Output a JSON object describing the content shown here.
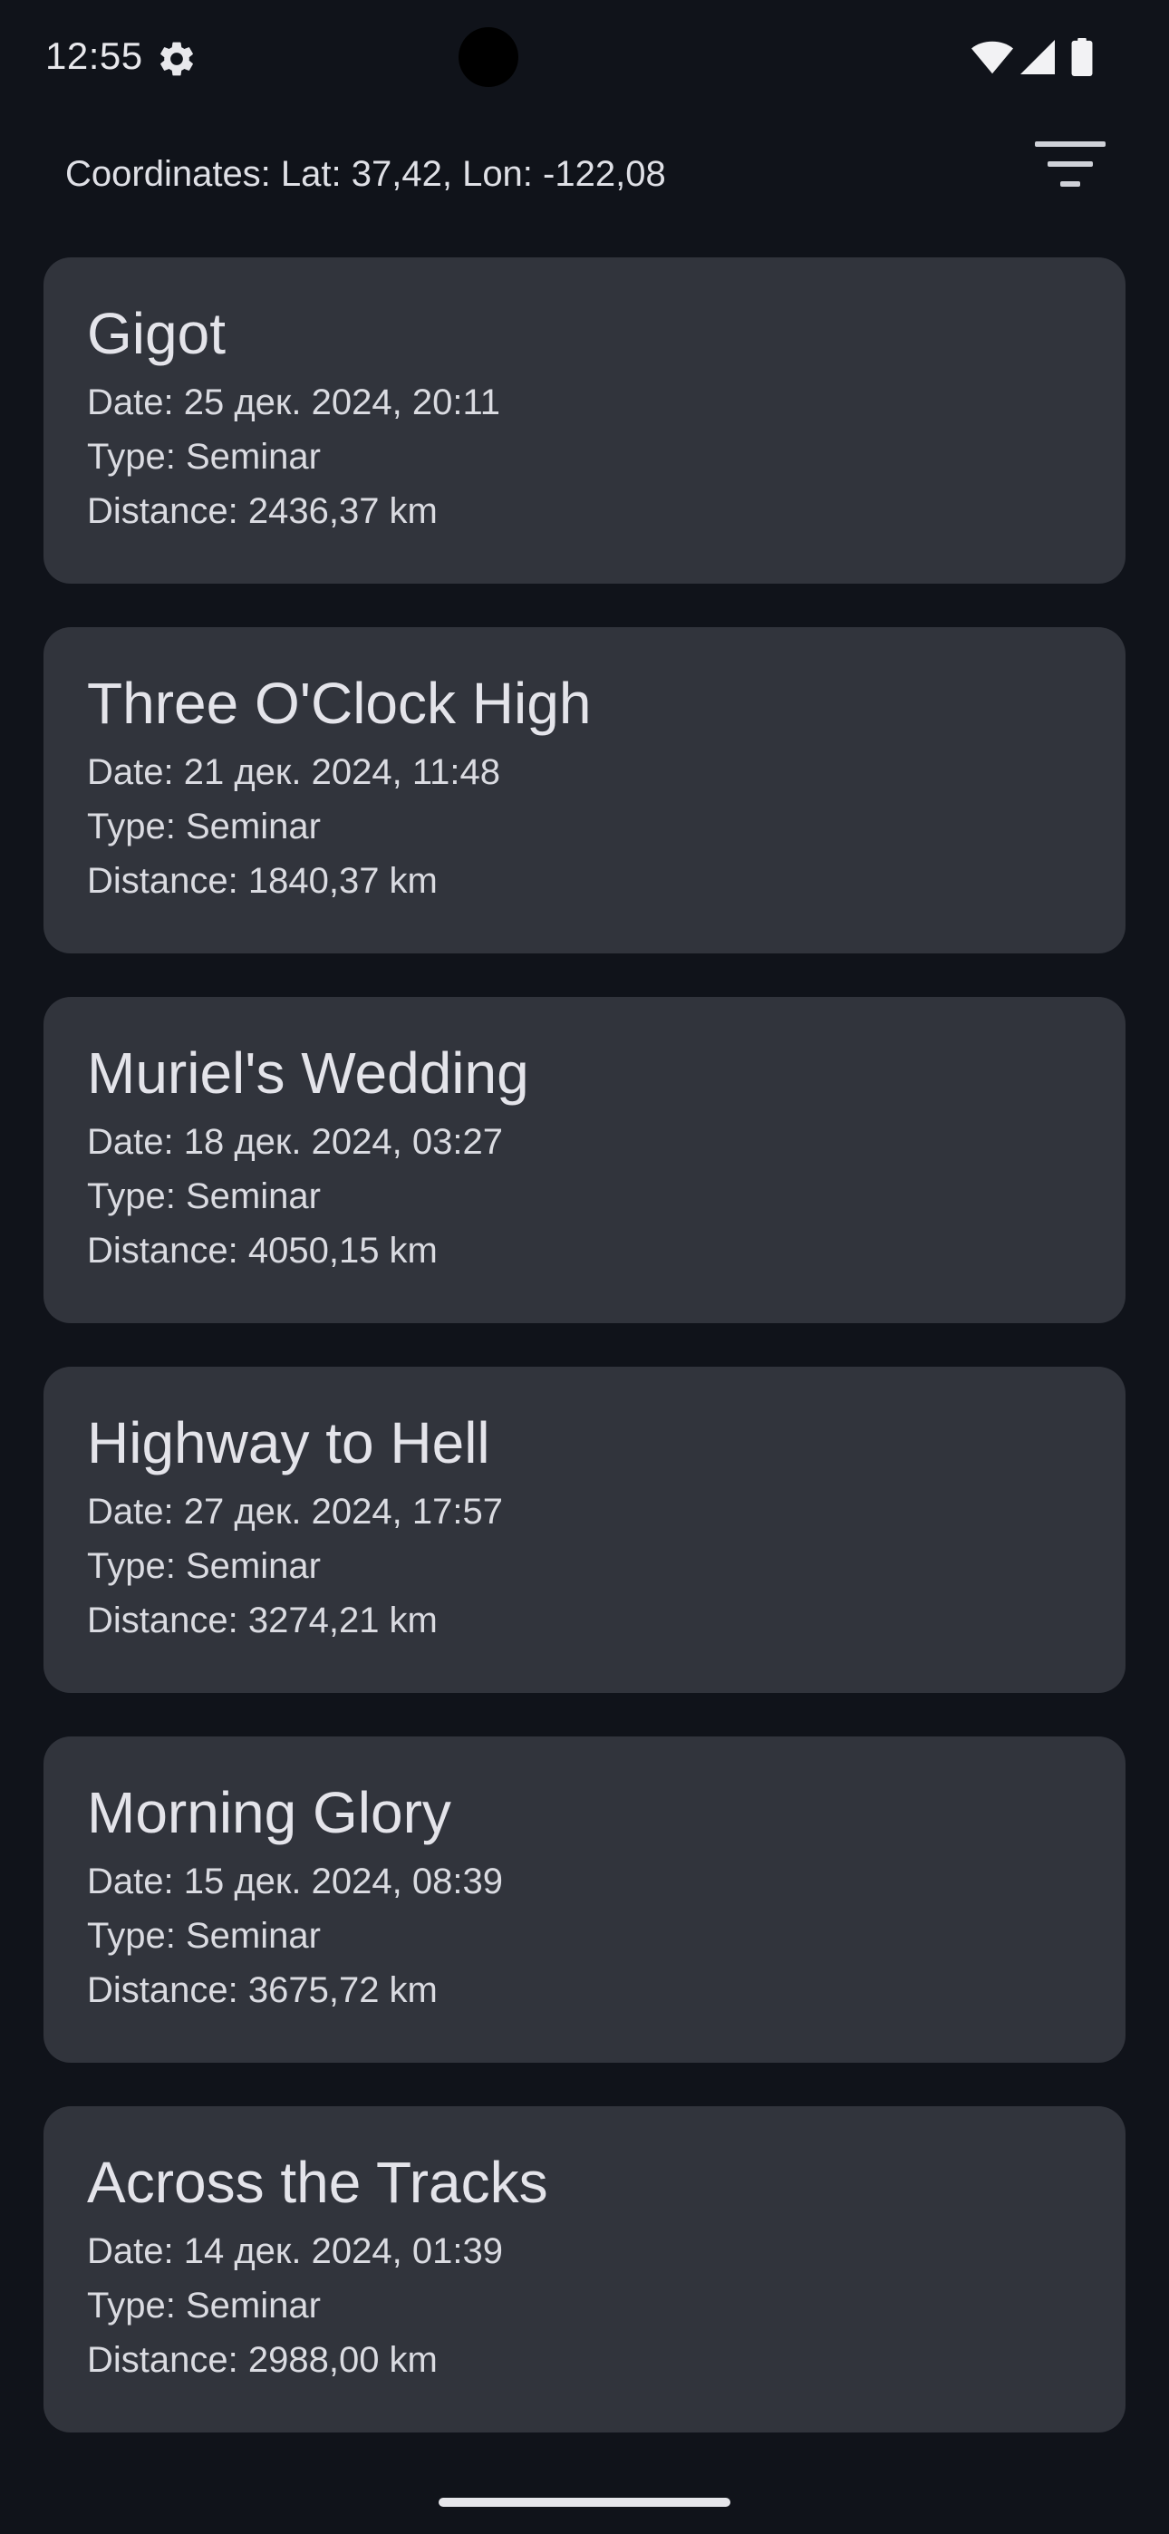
{
  "status_bar": {
    "time": "12:55",
    "icons": [
      "settings-gear-icon",
      "wifi-icon",
      "cellular-signal-icon",
      "battery-icon"
    ]
  },
  "header": {
    "coordinates": "Coordinates: Lat: 37,42, Lon: -122,08",
    "filter_icon": "filter-icon"
  },
  "events": [
    {
      "title": "Gigot",
      "date": "Date: 25 дек. 2024, 20:11",
      "type": "Type: Seminar",
      "distance": "Distance: 2436,37 km"
    },
    {
      "title": "Three O'Clock High",
      "date": "Date: 21 дек. 2024, 11:48",
      "type": "Type: Seminar",
      "distance": "Distance: 1840,37 km"
    },
    {
      "title": "Muriel's Wedding",
      "date": "Date: 18 дек. 2024, 03:27",
      "type": "Type: Seminar",
      "distance": "Distance: 4050,15 km"
    },
    {
      "title": "Highway to Hell",
      "date": "Date: 27 дек. 2024, 17:57",
      "type": "Type: Seminar",
      "distance": "Distance: 3274,21 km"
    },
    {
      "title": "Morning Glory",
      "date": "Date: 15 дек. 2024, 08:39",
      "type": "Type: Seminar",
      "distance": "Distance: 3675,72 km"
    },
    {
      "title": "Across the Tracks",
      "date": "Date: 14 дек. 2024, 01:39",
      "type": "Type: Seminar",
      "distance": "Distance: 2988,00 km"
    }
  ],
  "colors": {
    "background": "#10131a",
    "card": "#31343c",
    "text": "#e4e4ea"
  }
}
